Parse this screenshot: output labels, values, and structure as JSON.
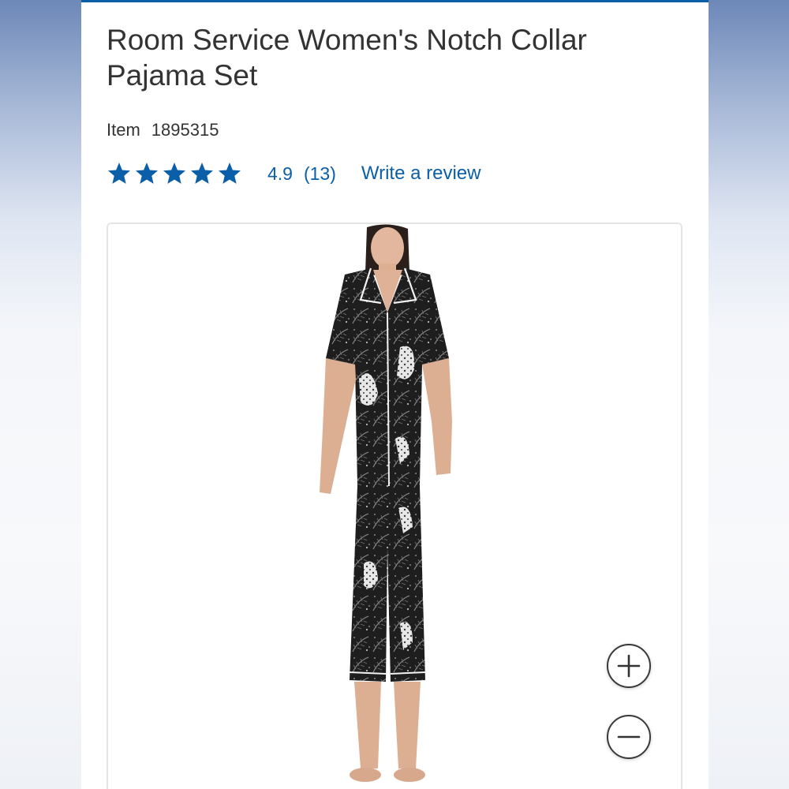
{
  "product": {
    "title": "Room Service Women's Notch Collar Pajama Set",
    "item_label": "Item",
    "item_number": "1895315"
  },
  "rating": {
    "stars_filled": 5,
    "stars_total": 5,
    "value": "4.9",
    "count": "(13)",
    "write_review_label": "Write a review"
  },
  "image": {
    "alt": "Model wearing black tropical leopard print short-sleeve notch collar pajama top and cropped pants with white piping"
  },
  "zoom": {
    "in_icon": "plus-icon",
    "out_icon": "minus-icon"
  },
  "colors": {
    "accent": "#0b5ea8",
    "title_text": "#333333",
    "star": "#0b5ea8"
  }
}
